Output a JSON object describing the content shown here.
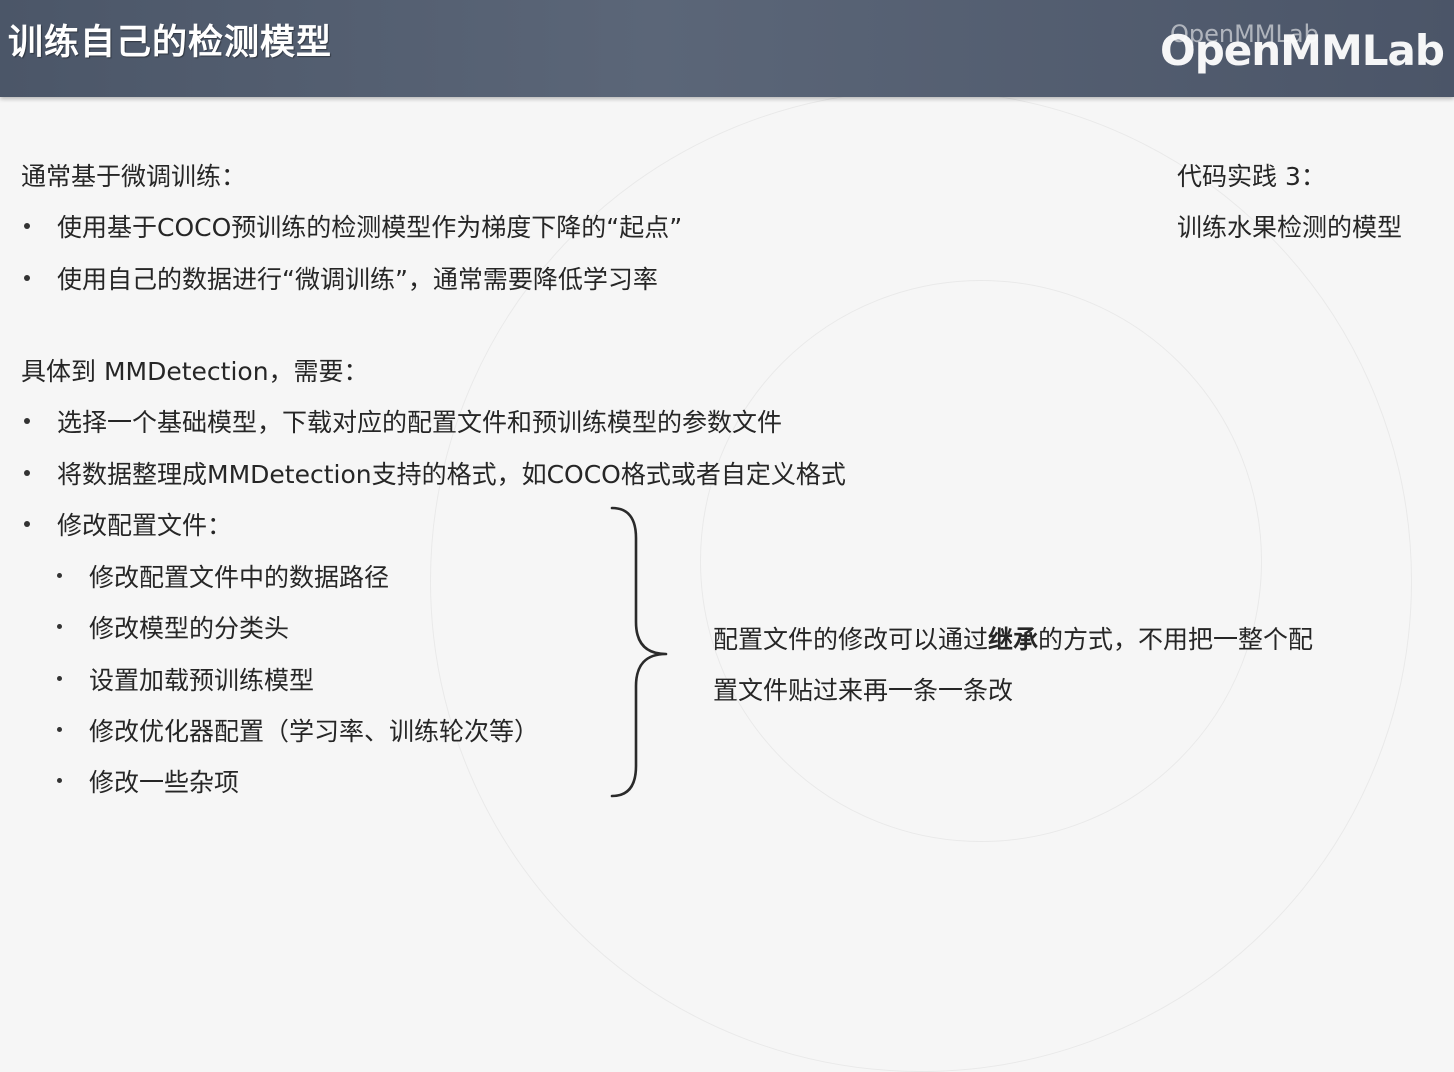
{
  "header": {
    "title": "训练自己的检测模型",
    "logo": "OpenMMLab",
    "logo_ghost": "OpenMMLab"
  },
  "intro": {
    "heading": "通常基于微调训练：",
    "bullets": [
      "使用基于COCO预训练的检测模型作为梯度下降的“起点”",
      "使用自己的数据进行“微调训练”，通常需要降低学习率"
    ]
  },
  "practice": {
    "line1": "代码实践 3：",
    "line2": "训练水果检测的模型"
  },
  "mmdet": {
    "heading": "具体到 MMDetection，需要：",
    "bullets": [
      "选择一个基础模型，下载对应的配置文件和预训练模型的参数文件",
      "将数据整理成MMDetection支持的格式，如COCO格式或者自定义格式",
      "修改配置文件："
    ],
    "sub_bullets": [
      "修改配置文件中的数据路径",
      "修改模型的分类头",
      "设置加载预训练模型",
      "修改优化器配置（学习率、训练轮次等）",
      "修改一些杂项"
    ]
  },
  "note": {
    "line1_before": "配置文件的修改可以通过",
    "line1_bold": "继承",
    "line1_after": "的方式，不用把一整个配",
    "line2": "置文件贴过来再一条一条改"
  }
}
